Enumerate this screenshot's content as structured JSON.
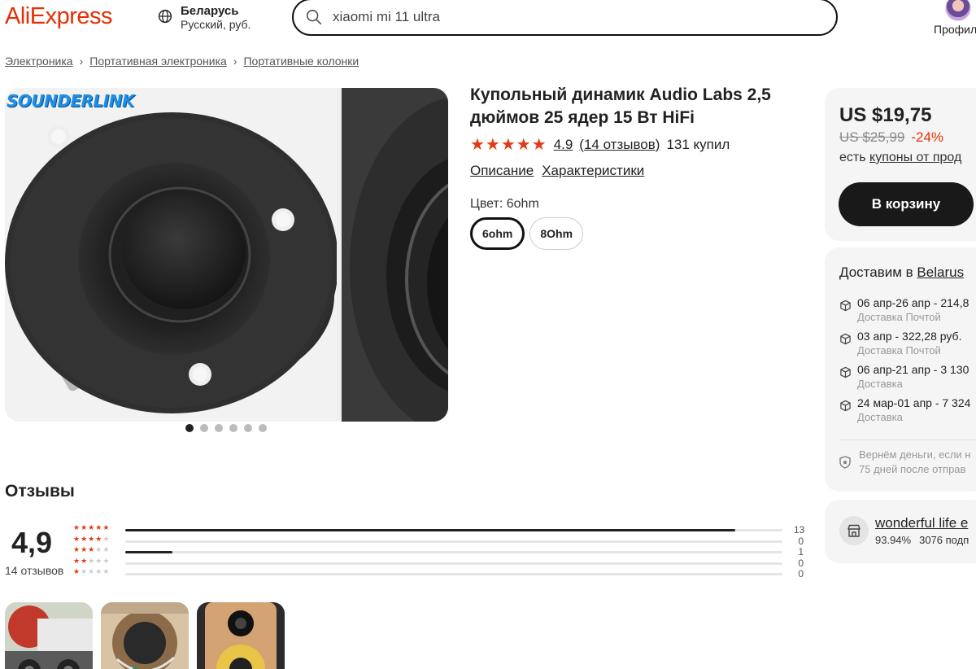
{
  "header": {
    "logo": "AliExpress",
    "region_country": "Беларусь",
    "region_lang_currency": "Русский, руб.",
    "search_value": "xiaomi mi 11 ultra",
    "profile_label": "Профиль"
  },
  "breadcrumb": [
    "Электроника",
    "Портативная электроника",
    "Портативные колонки"
  ],
  "gallery": {
    "brand_logo": "SOUNDERLINK",
    "dots_total": 6,
    "active_dot": 1
  },
  "product": {
    "title": "Купольный динамик Audio Labs 2,5 дюймов 25 ядер 15 Вт HiFi",
    "stars": 5,
    "rating": "4.9",
    "reviews_link": "(14 отзывов)",
    "sold": "131 купил",
    "links": [
      "Описание",
      "Характеристики"
    ],
    "color_label": "Цвет: 6ohm",
    "variants": [
      {
        "label": "6ohm",
        "selected": true
      },
      {
        "label": "8Ohm",
        "selected": false
      }
    ]
  },
  "buy_box": {
    "price": "US $19,75",
    "old_price": "US $25,99",
    "discount": "-24%",
    "coupon_prefix": "есть",
    "coupon_link": "купоны от прод",
    "cart_button": "В корзину"
  },
  "delivery": {
    "title_prefix": "Доставим в",
    "country": "Belarus",
    "options": [
      {
        "main": "06 апр-26 апр - 214,8",
        "sub": "Доставка Почтой"
      },
      {
        "main": "03 апр - 322,28 руб.",
        "sub": "Доставка Почтой"
      },
      {
        "main": "06 апр-21 апр - 3 130",
        "sub": "Доставка"
      },
      {
        "main": "24 мар-01 апр - 7 324",
        "sub": "Доставка"
      }
    ],
    "guarantee_line1": "Вернём деньги, если н",
    "guarantee_line2": "75 дней после отправ"
  },
  "store": {
    "name": "wonderful life e",
    "positive": "93.94%",
    "subscribers": "3076 подп"
  },
  "reviews": {
    "title": "Отзывы",
    "score": "4,9",
    "count_label": "14 отзывов",
    "histogram": [
      {
        "stars": 5,
        "count": 13
      },
      {
        "stars": 4,
        "count": 0
      },
      {
        "stars": 3,
        "count": 1
      },
      {
        "stars": 2,
        "count": 0
      },
      {
        "stars": 1,
        "count": 0
      }
    ]
  },
  "colors": {
    "brand": "#e62e04",
    "star": "#e23a13",
    "button": "#191919",
    "card_bg": "#f5f5f5"
  }
}
